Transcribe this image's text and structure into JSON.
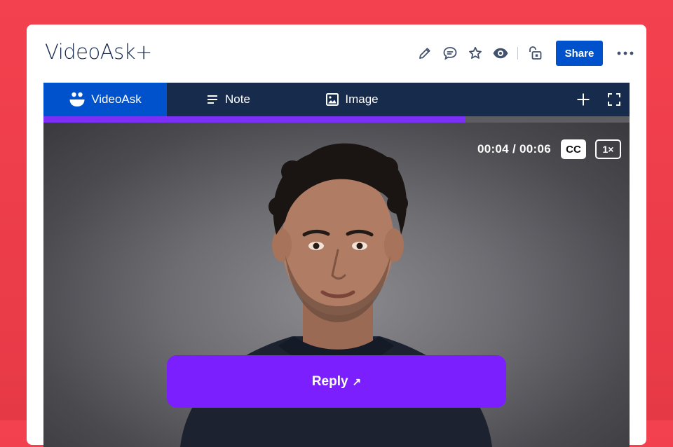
{
  "page": {
    "title": "VideoAsk+"
  },
  "toolbar": {
    "icons": [
      "edit-icon",
      "comment-icon",
      "star-icon",
      "watch-icon",
      "unlock-icon",
      "more-icon"
    ],
    "share_label": "Share",
    "share_color": "#0052cc"
  },
  "embed": {
    "tabs": [
      {
        "label": "VideoAsk",
        "icon": "videoask-icon",
        "active": true
      },
      {
        "label": "Note",
        "icon": "note-icon",
        "active": false
      },
      {
        "label": "Image",
        "icon": "image-icon",
        "active": false
      }
    ],
    "actions": [
      "add-icon",
      "fullscreen-icon"
    ],
    "tab_bar_color": "#172b4d",
    "active_tab_color": "#0052cc"
  },
  "player": {
    "progress_fraction": 0.72,
    "progress_color": "#7b2ff7",
    "time_current": "00:04",
    "time_separator": "/",
    "time_total": "00:06",
    "cc_label": "CC",
    "speed_label": "1×",
    "reply_label": "Reply",
    "reply_arrow": "↗",
    "reply_color": "#7b1fff"
  }
}
